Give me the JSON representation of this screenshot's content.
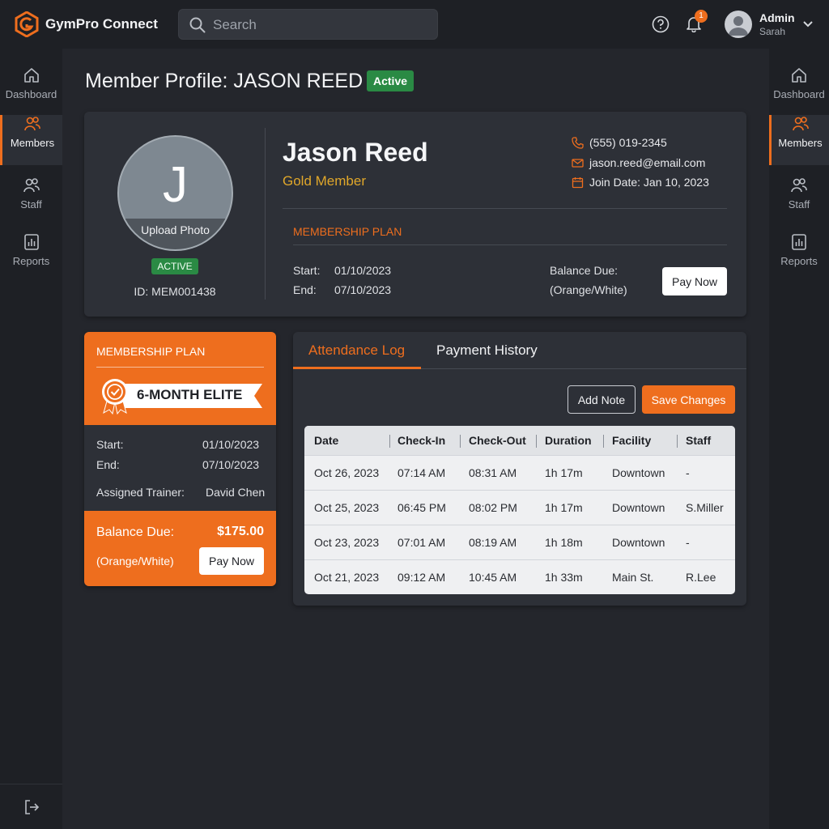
{
  "app": {
    "title": "GymPro Connect"
  },
  "search": {
    "placeholder": "Search"
  },
  "header": {
    "notification_count": "1",
    "user_name": "Admin",
    "user_sub": "Sarah"
  },
  "nav": {
    "items": [
      {
        "label": "Dashboard",
        "icon": "home-icon"
      },
      {
        "label": "Members",
        "icon": "members-icon"
      },
      {
        "label": "Staff",
        "icon": "staff-icon"
      },
      {
        "label": "Reports",
        "icon": "reports-icon"
      }
    ],
    "active": "Members"
  },
  "page": {
    "title": "Member Profile: JASON REED",
    "status_badge": "Active"
  },
  "profile": {
    "initial": "J",
    "upload_label": "Upload Photo",
    "status": "ACTIVE",
    "id_text": "ID: MEM001438",
    "name": "Jason Reed",
    "tier": "Gold Member",
    "phone": "(555) 019-2345",
    "email": "jason.reed@email.com",
    "join_date": "Join Date: Jan 10, 2023",
    "plan_heading": "MEMBERSHIP PLAN",
    "start_label": "Start:",
    "start_value": "01/10/2023",
    "end_label": "End:",
    "end_value": "07/10/2023",
    "balance_label": "Balance Due:",
    "balance_note": "(Orange/White)",
    "pay_now": "Pay Now"
  },
  "plan_card": {
    "title": "MEMBERSHIP PLAN",
    "plan_name": "6-MONTH ELITE",
    "start_label": "Start:",
    "start_value": "01/10/2023",
    "end_label": "End:",
    "end_value": "07/10/2023",
    "trainer_label": "Assigned Trainer:",
    "trainer_value": "David Chen",
    "balance_label": "Balance Due:",
    "balance_amount": "$175.00",
    "balance_note": "(Orange/White)",
    "pay_now": "Pay Now"
  },
  "attendance": {
    "tabs": [
      "Attendance Log",
      "Payment History"
    ],
    "add_note": "Add Note",
    "save_changes": "Save Changes",
    "columns": [
      "Date",
      "Check-In",
      "Check-Out",
      "Duration",
      "Facility",
      "Staff"
    ],
    "rows": [
      [
        "Oct 26, 2023",
        "07:14 AM",
        "08:31 AM",
        "1h 17m",
        "Downtown",
        "-"
      ],
      [
        "Oct 25, 2023",
        "06:45 PM",
        "08:02 PM",
        "1h 17m",
        "Downtown",
        "S.Miller"
      ],
      [
        "Oct 23, 2023",
        "07:01 AM",
        "08:19 AM",
        "1h 18m",
        "Downtown",
        "-"
      ],
      [
        "Oct 21, 2023",
        "09:12 AM",
        "10:45 AM",
        "1h 33m",
        "Main St.",
        "R.Lee"
      ]
    ]
  },
  "colors": {
    "accent": "#ee6e1e",
    "success": "#2a8a44",
    "gold": "#e0a72a",
    "background": "#1c1e23"
  }
}
